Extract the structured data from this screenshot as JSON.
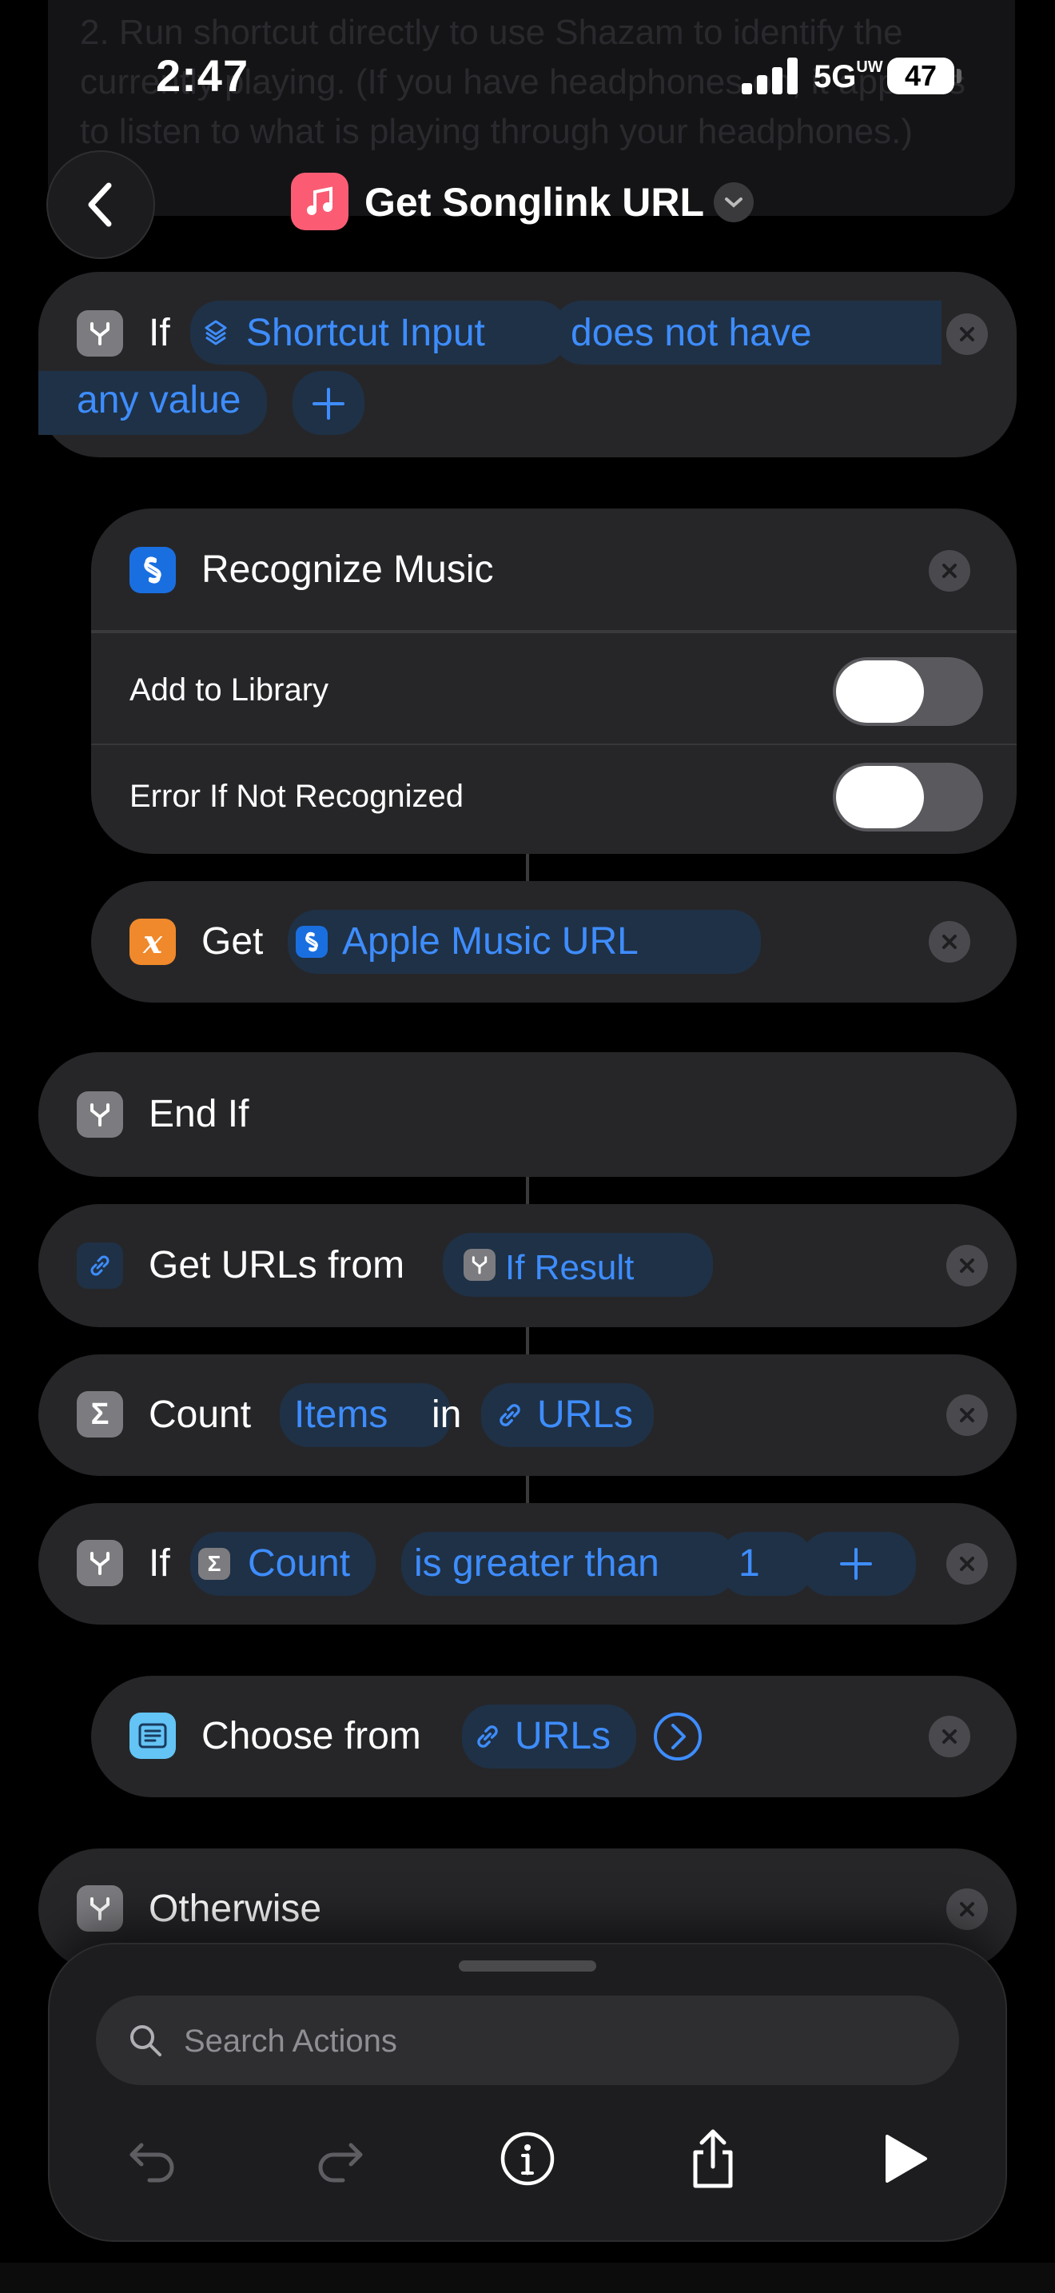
{
  "background_text": "2. Run shortcut directly to use Shazam to identify the currently playing. (If you have headphones on, it appears to listen to what is playing through your headphones.)",
  "status_bar": {
    "time": "2:47",
    "network": "5G",
    "network_sup": "UW",
    "battery": "47"
  },
  "header": {
    "title": "Get Songlink URL"
  },
  "actions": {
    "if1": {
      "keyword": "If",
      "var": "Shortcut Input",
      "condition": "does not have",
      "condition2": "any value"
    },
    "recognize": {
      "title": "Recognize Music",
      "option1": "Add to Library",
      "option2": "Error If Not Recognized"
    },
    "get": {
      "keyword": "Get",
      "token": "Apple Music URL"
    },
    "endif": {
      "label": "End If"
    },
    "get_urls": {
      "label": "Get URLs from",
      "token": "If Result"
    },
    "count": {
      "label": "Count",
      "token1": "Items",
      "word": "in",
      "token2": "URLs"
    },
    "if2": {
      "keyword": "If",
      "var": "Count",
      "condition": "is greater than",
      "value": "1"
    },
    "choose": {
      "label": "Choose from",
      "token": "URLs"
    },
    "otherwise": {
      "label": "Otherwise"
    }
  },
  "bottom_panel": {
    "search_placeholder": "Search Actions"
  },
  "colors": {
    "accent": "#3e8dff",
    "card": "#262629",
    "background": "#000000",
    "toggle_off": "#5a5a5e"
  },
  "icons": [
    "back-chevron-icon",
    "music-note-icon",
    "chevron-down-icon",
    "branch-icon",
    "layers-icon",
    "plus-icon",
    "close-icon",
    "shazam-icon",
    "variable-x-icon",
    "link-icon",
    "sigma-icon",
    "list-icon",
    "arrow-circle-right-icon",
    "magnifier-icon",
    "undo-icon",
    "redo-icon",
    "info-icon",
    "share-icon",
    "play-icon"
  ]
}
